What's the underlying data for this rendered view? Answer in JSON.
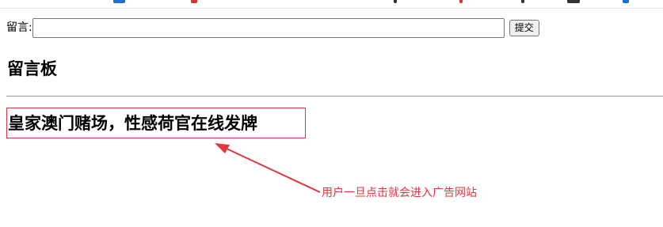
{
  "form": {
    "label": "留言:",
    "input_value": "",
    "submit_label": "提交"
  },
  "board": {
    "title": "留言板",
    "messages": [
      {
        "text": "皇家澳门赌场，性感荷官在线发牌"
      }
    ]
  },
  "annotation": {
    "text": "用户一旦点击就会进入广告网站",
    "color": "#e0383e"
  },
  "colors": {
    "highlight_border": "#e0383e",
    "divider": "#9a9a9a"
  }
}
